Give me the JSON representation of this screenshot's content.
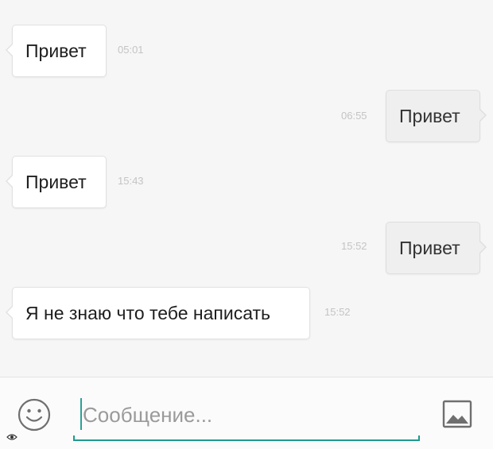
{
  "messages": [
    {
      "text": "Привет",
      "time": "05:01",
      "direction": "incoming"
    },
    {
      "text": "Привет",
      "time": "06:55",
      "direction": "outgoing"
    },
    {
      "text": "Привет",
      "time": "15:43",
      "direction": "incoming"
    },
    {
      "text": "Привет",
      "time": "15:52",
      "direction": "outgoing"
    },
    {
      "text": "Я не знаю что тебе написать",
      "time": "15:52",
      "direction": "incoming"
    }
  ],
  "composer": {
    "placeholder": "Сообщение...",
    "value": "",
    "emoji_icon": "smiley-face-icon",
    "attach_icon": "image-attach-icon",
    "accent_color": "#1f9a8d"
  },
  "colors": {
    "incoming_bubble": "#ffffff",
    "outgoing_bubble": "#efefef",
    "background": "#f6f6f6",
    "timestamp": "#c4c4c4"
  }
}
